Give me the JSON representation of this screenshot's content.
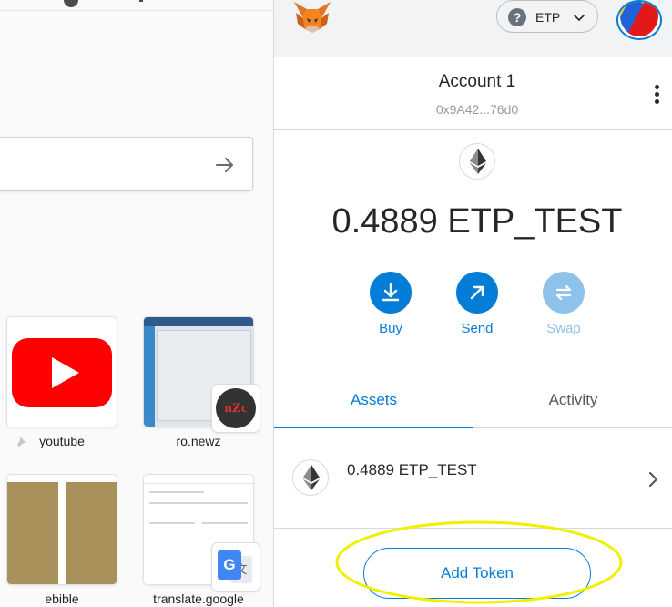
{
  "browser": {
    "top_sites": [
      {
        "label": "youtube"
      },
      {
        "label": "ro.newz",
        "badge_text": "nZc"
      },
      {
        "label": "ebible"
      },
      {
        "label": "translate.google"
      }
    ]
  },
  "metamask": {
    "network": {
      "label": "ETP",
      "icon": "question-icon"
    },
    "account": {
      "name": "Account 1",
      "address": "0x9A42...76d0"
    },
    "balance": "0.4889 ETP_TEST",
    "actions": [
      {
        "label": "Buy",
        "icon": "download-icon",
        "enabled": true
      },
      {
        "label": "Send",
        "icon": "arrow-up-right-icon",
        "enabled": true
      },
      {
        "label": "Swap",
        "icon": "swap-icon",
        "enabled": false
      }
    ],
    "tabs": {
      "assets": "Assets",
      "activity": "Activity",
      "active": "Assets"
    },
    "asset": {
      "amount": "0.4889 ETP_TEST",
      "icon": "eth-icon"
    },
    "add_token_label": "Add Token",
    "colors": {
      "accent": "#037dd6",
      "accent_disabled": "#8ec2eb",
      "highlight": "#f0f000"
    }
  }
}
